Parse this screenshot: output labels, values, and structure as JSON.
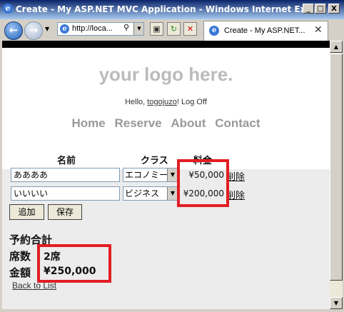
{
  "window": {
    "title": "Create - My ASP.NET MVC Application - Windows Internet Expl...",
    "controls": [
      "_",
      "□",
      "X"
    ]
  },
  "browser": {
    "address": "http://loca...",
    "tab_title": "Create - My ASP.NET...",
    "tab_close": "✕"
  },
  "site": {
    "logo": "your logo here.",
    "login": {
      "prefix": "Hello, ",
      "user": "togojuzo",
      "suffix": "! ",
      "logoff": "Log Off"
    },
    "menu": [
      "Home",
      "Reserve",
      "About",
      "Contact"
    ]
  },
  "form": {
    "headers": {
      "name": "名前",
      "class": "クラス",
      "price": "料金"
    },
    "rows": [
      {
        "name": "ああああ",
        "class": "エコノミー",
        "price": "¥50,000",
        "delete": "削除"
      },
      {
        "name": "いいいい",
        "class": "ビジネス",
        "price": "¥200,000",
        "delete": "削除"
      }
    ],
    "buttons": {
      "add": "追加",
      "save": "保存"
    }
  },
  "summary": {
    "title": "予約合計",
    "seats_label": "席数",
    "seats_value": "2席",
    "amount_label": "金額",
    "amount_value": "¥250,000"
  },
  "back_link": "Back to List",
  "colors": {
    "highlight": "#e21d23",
    "title_bar": "#0a246a",
    "logo": "#bbbbbb"
  }
}
